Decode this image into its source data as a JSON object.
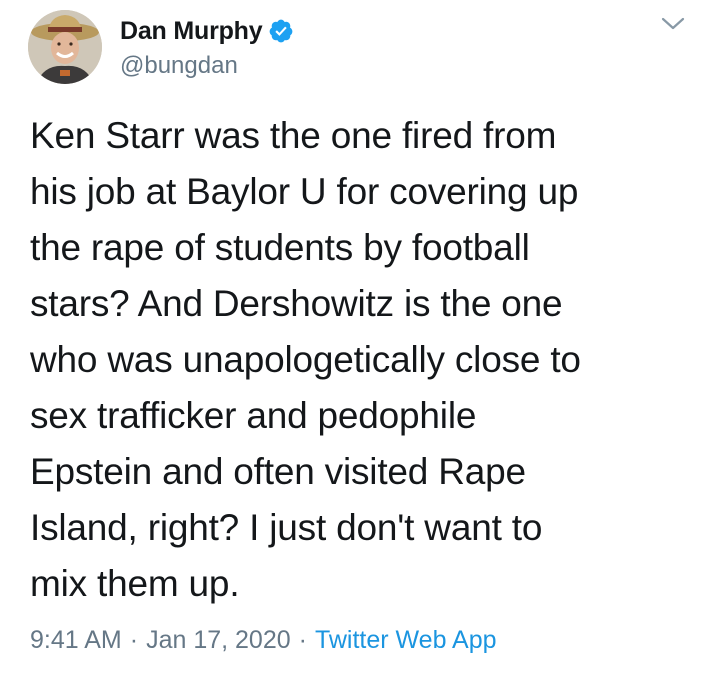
{
  "user": {
    "display_name": "Dan Murphy",
    "handle": "@bungdan",
    "verified": true
  },
  "tweet": {
    "text": "Ken Starr was the one fired from\nhis job at Baylor U for covering up\nthe rape of students by football\nstars? And Dershowitz is the one\nwho was unapologetically close to\nsex trafficker and pedophile\nEpstein and often visited Rape\nIsland, right? I just don't want to\nmix them up."
  },
  "meta": {
    "time": "9:41 AM",
    "separator": "·",
    "date": "Jan 17, 2020",
    "source": "Twitter Web App"
  },
  "icons": {
    "verified": "verified-badge-icon",
    "menu": "chevron-down-icon"
  },
  "colors": {
    "text": "#14171a",
    "secondary": "#657786",
    "link": "#1b95e0",
    "verified": "#1da1f2"
  }
}
